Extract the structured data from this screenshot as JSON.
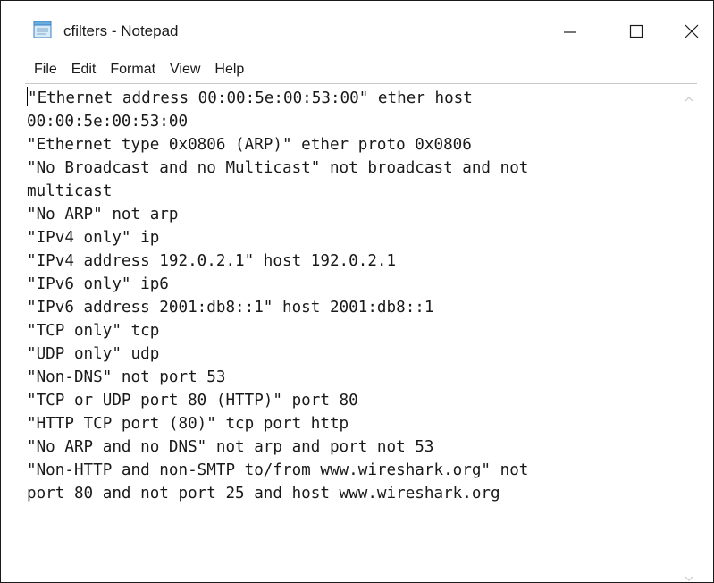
{
  "window": {
    "title": "cfilters - Notepad"
  },
  "menu": {
    "items": [
      "File",
      "Edit",
      "Format",
      "View",
      "Help"
    ]
  },
  "editor": {
    "lines": [
      "\"Ethernet address 00:00:5e:00:53:00\" ether host",
      "00:00:5e:00:53:00",
      "\"Ethernet type 0x0806 (ARP)\" ether proto 0x0806",
      "\"No Broadcast and no Multicast\" not broadcast and not",
      "multicast",
      "\"No ARP\" not arp",
      "\"IPv4 only\" ip",
      "\"IPv4 address 192.0.2.1\" host 192.0.2.1",
      "\"IPv6 only\" ip6",
      "\"IPv6 address 2001:db8::1\" host 2001:db8::1",
      "\"TCP only\" tcp",
      "\"UDP only\" udp",
      "\"Non-DNS\" not port 53",
      "\"TCP or UDP port 80 (HTTP)\" port 80",
      "\"HTTP TCP port (80)\" tcp port http",
      "\"No ARP and no DNS\" not arp and port not 53",
      "\"Non-HTTP and non-SMTP to/from www.wireshark.org\" not",
      "port 80 and not port 25 and host www.wireshark.org"
    ]
  },
  "icons": {
    "app": "notepad-icon",
    "minimize": "minimize-icon",
    "maximize": "maximize-icon",
    "close": "close-icon"
  }
}
